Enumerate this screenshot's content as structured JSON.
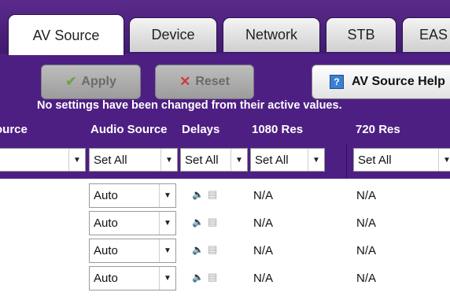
{
  "tabs": [
    {
      "label": "AV Source",
      "active": true
    },
    {
      "label": "Device",
      "active": false
    },
    {
      "label": "Network",
      "active": false
    },
    {
      "label": "STB",
      "active": false
    },
    {
      "label": "EAS",
      "active": false
    }
  ],
  "toolbar": {
    "apply_label": "Apply",
    "reset_label": "Reset",
    "help_label": "AV Source Help",
    "help_icon_glyph": "?"
  },
  "status_message": "No settings have been changed from their active values.",
  "columns": [
    "Source",
    "Audio Source",
    "Delays",
    "1080 Res",
    "720 Res"
  ],
  "set_all": {
    "source": "",
    "audio_source": "Set All",
    "delays": "Set All",
    "res_1080": "Set All",
    "res_720": "Set All"
  },
  "rows": [
    {
      "audio_source": "Auto",
      "res_1080": "N/A",
      "res_720": "N/A"
    },
    {
      "audio_source": "Auto",
      "res_1080": "N/A",
      "res_720": "N/A"
    },
    {
      "audio_source": "Auto",
      "res_1080": "N/A",
      "res_720": "N/A"
    },
    {
      "audio_source": "Auto",
      "res_1080": "N/A",
      "res_720": "N/A"
    }
  ],
  "icons": {
    "speaker": "speaker-icon",
    "film": "film-icon",
    "dropdown": "chevron-down-icon"
  },
  "colors": {
    "header_purple": "#4e1f83",
    "apply_check": "#6fa34a",
    "reset_x": "#d23a3a"
  }
}
